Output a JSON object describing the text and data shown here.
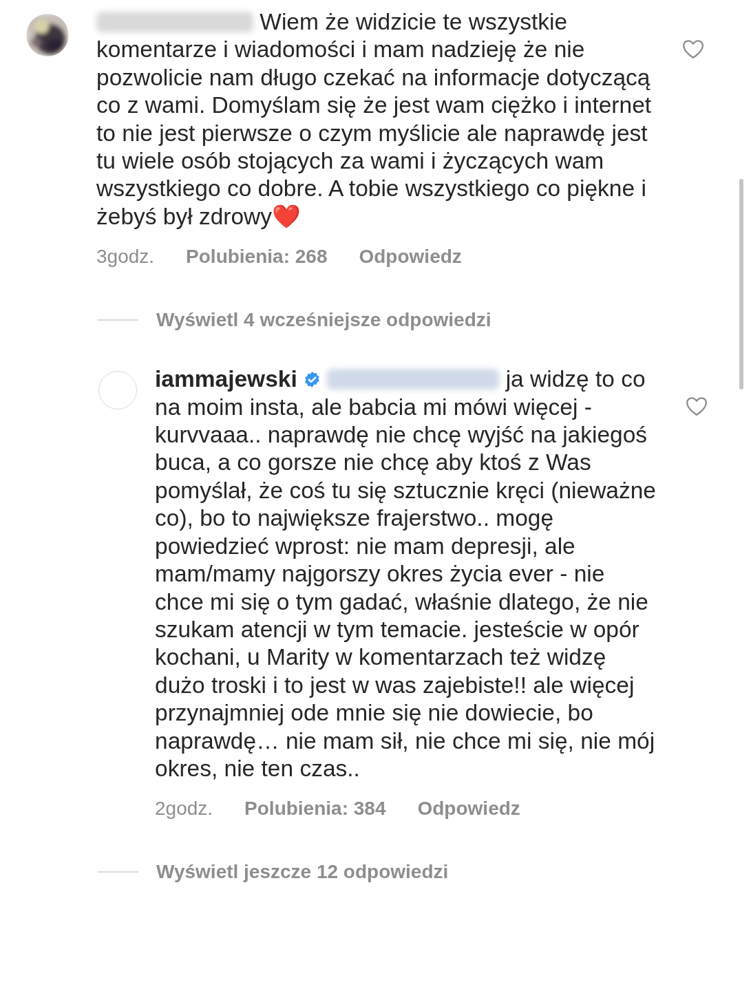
{
  "comments": [
    {
      "author": {
        "blurred": true
      },
      "text": "Wiem że widzicie te wszystkie komentarze i wiadomości i mam nadzieję że nie pozwolicie nam długo czekać na informacje dotyczącą co z wami. Domyślam się że jest wam ciężko i internet to nie jest pierwsze o czym myślicie ale naprawdę jest tu wiele osób stojących za wami i życzących wam wszystkiego co dobre. A tobie wszystkiego co piękne i żebyś był zdrowy",
      "emoji": "❤️",
      "time": "3godz.",
      "likes": "Polubienia: 268",
      "reply": "Odpowiedz",
      "liked": false,
      "replies_link": {
        "text": "Wyświetl 4 wcześniejsze odpowiedzi",
        "line": true
      }
    },
    {
      "avatar": {
        "kind": "empty"
      },
      "author": {
        "name": "iammajewski",
        "verified": true
      },
      "mention": {
        "blurred": true
      },
      "text": "ja widzę to co na moim insta, ale babcia mi mówi więcej - kurvvaaa.. naprawdę nie chcę wyjść na jakiegoś buca, a co gorsze nie chcę aby ktoś z Was pomyślał, że coś tu się sztucznie kręci (nieważne co), bo to największe frajerstwo.. mogę powiedzieć wprost: nie mam depresji, ale mam/mamy najgorszy okres życia ever - nie chce mi się o tym gadać, właśnie dlatego, że nie szukam atencji w tym temacie. jesteście w opór kochani, u Marity w komentarzach też widzę dużo troski i to jest w was zajebiste!! ale więcej przynajmniej ode mnie się nie dowiecie, bo naprawdę… nie mam sił, nie chce mi się, nie mój okres, nie ten czas..",
      "time": "2godz.",
      "likes": "Polubienia: 384",
      "reply": "Odpowiedz",
      "liked": false,
      "replies_link": {
        "text": "Wyświetl jeszcze 12 odpowiedzi",
        "line": true
      }
    }
  ]
}
